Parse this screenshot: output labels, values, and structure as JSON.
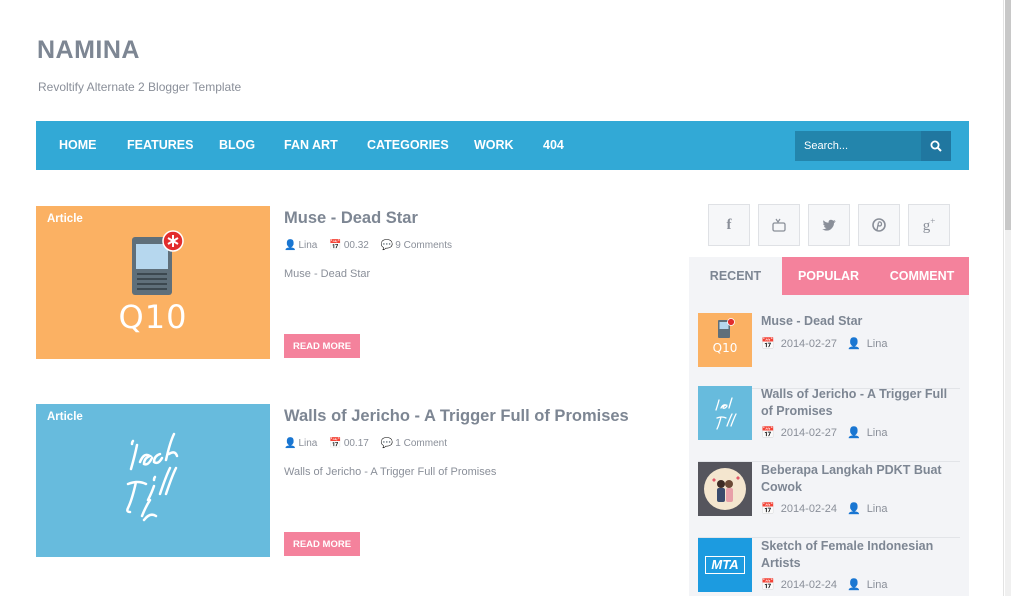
{
  "header": {
    "title": "NAMINA",
    "description": "Revoltify Alternate 2 Blogger Template"
  },
  "nav": {
    "items": [
      "HOME",
      "FEATURES",
      "BLOG",
      "FAN ART",
      "CATEGORIES",
      "WORK",
      "404"
    ],
    "search_placeholder": "Search..."
  },
  "posts": [
    {
      "label": "Article",
      "title": "Muse - Dead Star",
      "author": "Lina",
      "time": "00.32",
      "comments": "9 Comments",
      "excerpt": "Muse - Dead Star",
      "read_more": "READ MORE",
      "thumb_text": "Q10",
      "thumb_color": "#fbb163"
    },
    {
      "label": "Article",
      "title": "Walls of Jericho - A Trigger Full of Promises",
      "author": "Lina",
      "time": "00.17",
      "comments": "1 Comment",
      "excerpt": "Walls of Jericho - A Trigger Full of Promises",
      "read_more": "READ MORE",
      "thumb_color": "#67bbdd"
    }
  ],
  "sidebar": {
    "social": [
      "facebook-icon",
      "youtube-icon",
      "twitter-icon",
      "pinterest-icon",
      "google-plus-icon"
    ],
    "tabs": [
      "RECENT",
      "POPULAR",
      "COMMENT"
    ],
    "recent": [
      {
        "title": "Muse - Dead Star",
        "date": "2014-02-27",
        "author": "Lina",
        "thumb_text": "Q10"
      },
      {
        "title": "Walls of Jericho - A Trigger Full of Promises",
        "date": "2014-02-27",
        "author": "Lina"
      },
      {
        "title": "Beberapa Langkah PDKT Buat Cowok",
        "date": "2014-02-24",
        "author": "Lina"
      },
      {
        "title": "Sketch of Female Indonesian Artists",
        "date": "2014-02-24",
        "author": "Lina",
        "thumb_text": "MTA"
      }
    ]
  },
  "colors": {
    "nav": "#32a9d6",
    "accent_pink": "#f4829c",
    "text": "#7d8693"
  }
}
